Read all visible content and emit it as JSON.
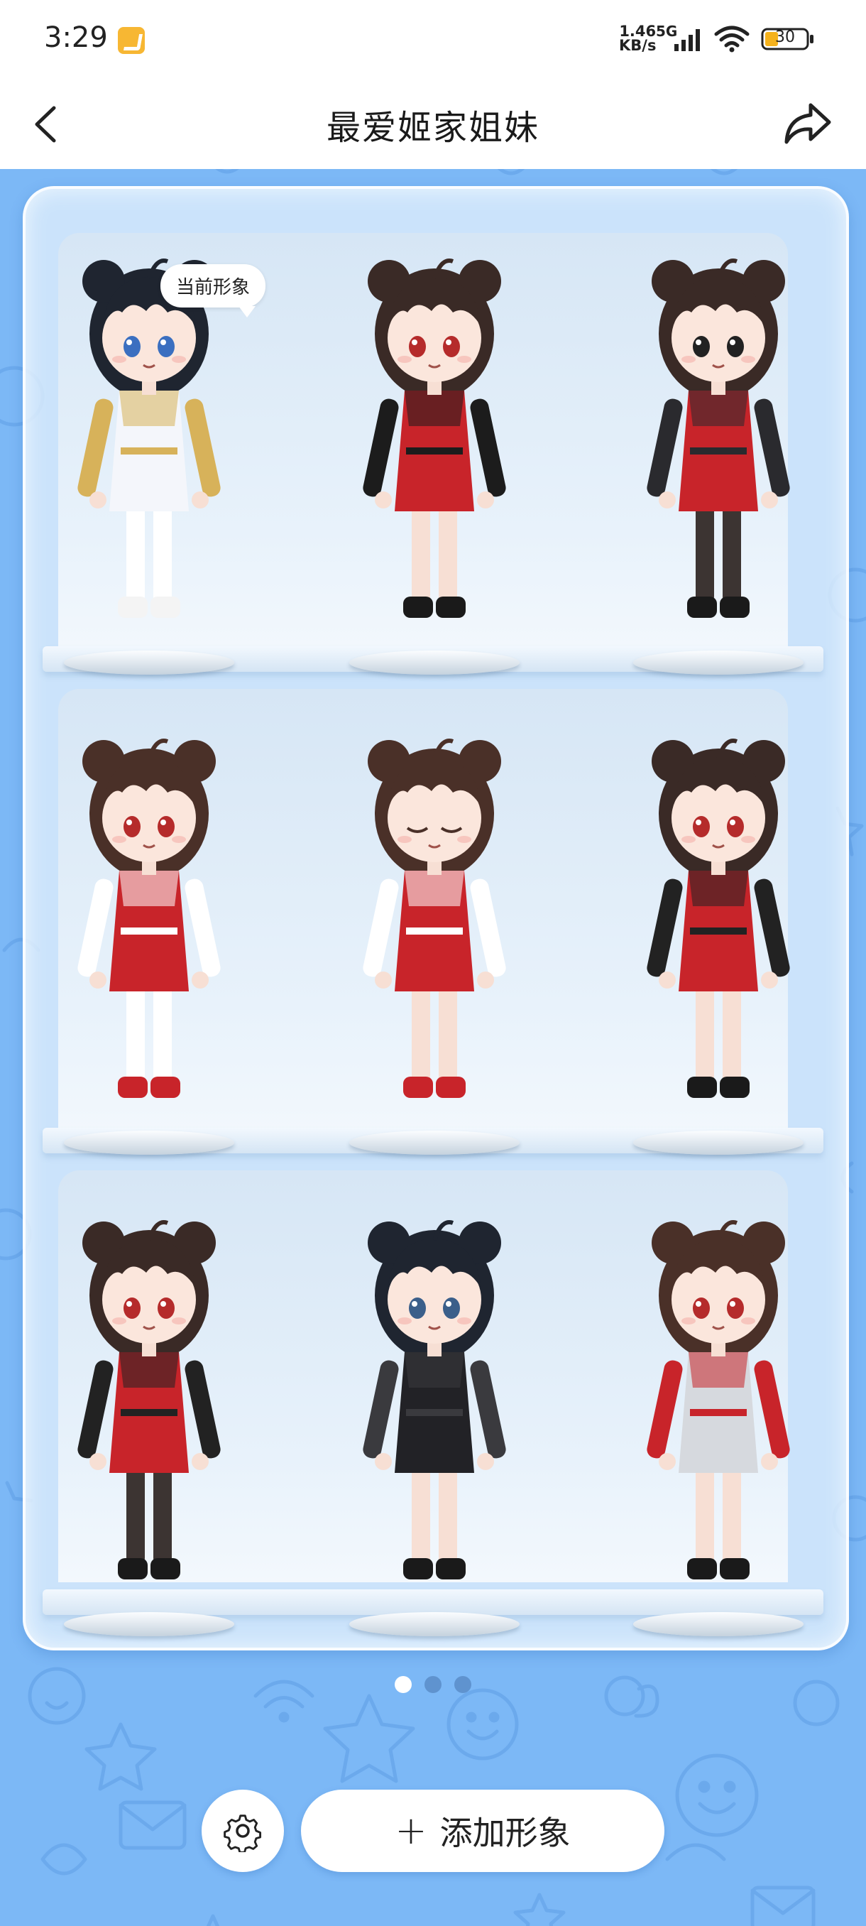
{
  "status_bar": {
    "time": "3:29",
    "net_speed_value": "1.46",
    "net_speed_unit": "KB/s",
    "network": "5G",
    "battery": "30"
  },
  "nav": {
    "title": "最爱姬家姐妹"
  },
  "current_badge": "当前形象",
  "avatars": [
    {
      "name": "white-dress-avatar",
      "hair": "#1f2530",
      "outfit": "#f4f6fb",
      "accent": "#d7b25a",
      "legs": "#ffffff",
      "shoes": "#f4f4f4",
      "eyes": "#3b6fc0"
    },
    {
      "name": "red-qipao-avatar",
      "hair": "#3a2a26",
      "outfit": "#c8242a",
      "accent": "#1c1c1c",
      "legs": "#f7dfd4",
      "shoes": "#1a1a1a",
      "eyes": "#b52b2b"
    },
    {
      "name": "sunglasses-coat-avatar",
      "hair": "#3a2a26",
      "outfit": "#c8242a",
      "accent": "#2a2a2e",
      "legs": "#3c3432",
      "shoes": "#1a1a1a",
      "eyes": "#222222"
    },
    {
      "name": "maid-outfit-avatar",
      "hair": "#4a3028",
      "outfit": "#c8242a",
      "accent": "#ffffff",
      "legs": "#ffffff",
      "shoes": "#c8242a",
      "eyes": "#b52b2b"
    },
    {
      "name": "maid-outfit-eyes-closed-avatar",
      "hair": "#4a3028",
      "outfit": "#c8242a",
      "accent": "#ffffff",
      "legs": "#f7dfd4",
      "shoes": "#c8242a",
      "eyes": "#4a3028"
    },
    {
      "name": "red-jacket-avatar",
      "hair": "#3a2a26",
      "outfit": "#c8242a",
      "accent": "#222222",
      "legs": "#f7dfd4",
      "shoes": "#1a1a1a",
      "eyes": "#b52b2b"
    },
    {
      "name": "red-jacket-tights-avatar",
      "hair": "#3a2a26",
      "outfit": "#c8242a",
      "accent": "#222222",
      "legs": "#3c3432",
      "shoes": "#1a1a1a",
      "eyes": "#b52b2b"
    },
    {
      "name": "black-outfit-avatar",
      "hair": "#1f2530",
      "outfit": "#222226",
      "accent": "#3a3a3e",
      "legs": "#f7dfd4",
      "shoes": "#1a1a1a",
      "eyes": "#3b5f8a"
    },
    {
      "name": "white-jacket-avatar",
      "hair": "#4a3028",
      "outfit": "#d6d9de",
      "accent": "#c8242a",
      "legs": "#f7dfd4",
      "shoes": "#1a1a1a",
      "eyes": "#b52b2b"
    }
  ],
  "pagination": {
    "current": 1,
    "total": 3
  },
  "bottom": {
    "add_label": "添加形象",
    "settings_icon": "gear-icon",
    "add_icon": "plus-icon"
  }
}
